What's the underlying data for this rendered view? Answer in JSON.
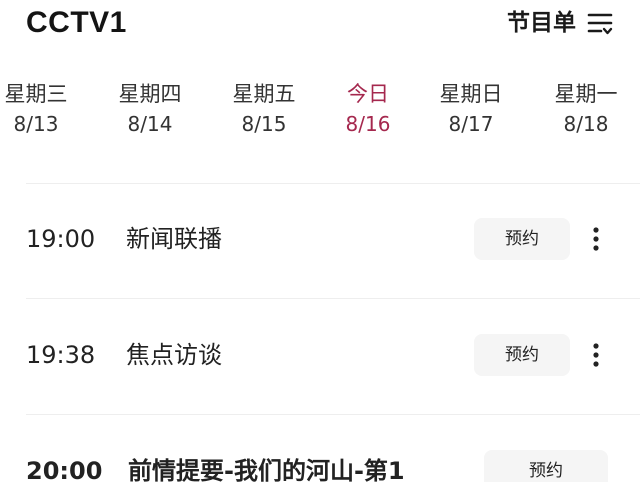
{
  "header": {
    "channel": "CCTV1",
    "schedule_label": "节目单",
    "menu_icon": "menu-sort-icon"
  },
  "date_tabs": [
    {
      "weekday": "星期三",
      "date": "8/13",
      "active": false
    },
    {
      "weekday": "星期四",
      "date": "8/14",
      "active": false
    },
    {
      "weekday": "星期五",
      "date": "8/15",
      "active": false
    },
    {
      "weekday": "今日",
      "date": "8/16",
      "active": true
    },
    {
      "weekday": "星期日",
      "date": "8/17",
      "active": false
    },
    {
      "weekday": "星期一",
      "date": "8/18",
      "active": false
    }
  ],
  "programs": [
    {
      "time": "19:00",
      "title": "新闻联播",
      "action": "预约"
    },
    {
      "time": "19:38",
      "title": "焦点访谈",
      "action": "预约"
    },
    {
      "time": "20:00",
      "title": "前情提要-我们的河山-第1",
      "action": "预约"
    }
  ],
  "colors": {
    "accent": "#a5284e",
    "text": "#222222",
    "button_bg": "#f5f5f5"
  }
}
